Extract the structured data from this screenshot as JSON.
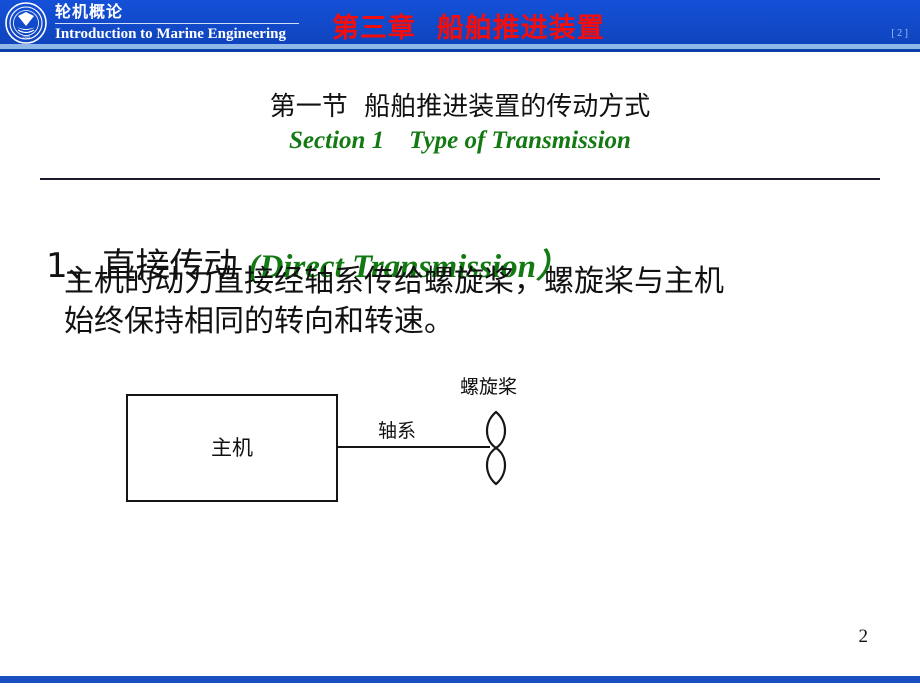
{
  "header": {
    "logo_icon": "university-emblem-icon",
    "brand_cn": "轮机概论",
    "brand_en": "Introduction to Marine Engineering",
    "chapter_title": "第三章  船舶推进装置",
    "slide_index": "[ 2 ]",
    "bar_color": "#1049c8",
    "title_color": "#f40d0d"
  },
  "section": {
    "title_cn": "第一节  船舶推进装置的传动方式",
    "title_en": "Section 1    Type of Transmission",
    "title_en_color": "#137a13"
  },
  "heading": {
    "cn": "1、直接传动 ",
    "en": "(Direct Transmission）"
  },
  "body": {
    "line_1": "主机的动力直接经轴系传给螺旋桨，螺旋桨与主机",
    "line_2": "始终保持相同的转向和转速。"
  },
  "diagram": {
    "engine_label": "主机",
    "shaft_label": "轴系",
    "propeller_label": "螺旋桨",
    "propeller_icon": "propeller-icon",
    "stroke_color": "#151515"
  },
  "footer": {
    "page_number": "2",
    "bar_color": "#1a4fc0"
  }
}
